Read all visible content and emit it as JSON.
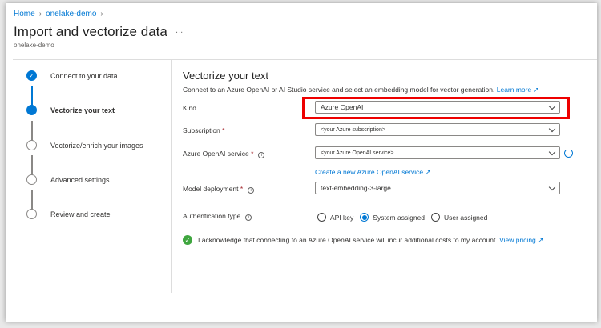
{
  "breadcrumb": [
    "Home",
    "onelake-demo"
  ],
  "header": {
    "title": "Import and vectorize data",
    "more": "...",
    "subtitle": "onelake-demo"
  },
  "steps": [
    {
      "label": "Connect to your data",
      "state": "done"
    },
    {
      "label": "Vectorize your text",
      "state": "current"
    },
    {
      "label": "Vectorize/enrich your images",
      "state": "pending"
    },
    {
      "label": "Advanced settings",
      "state": "pending"
    },
    {
      "label": "Review and create",
      "state": "pending"
    }
  ],
  "main": {
    "title": "Vectorize your text",
    "description": "Connect to an Azure OpenAI or AI Studio service and select an embedding model for vector generation.",
    "learn_more": "Learn more",
    "kind": {
      "label": "Kind",
      "value": "Azure OpenAI"
    },
    "subscription": {
      "label": "Subscription",
      "required": "*",
      "value": "<your Azure subscription>"
    },
    "service": {
      "label": "Azure OpenAI service",
      "required": "*",
      "value": "<your Azure OpenAI service>",
      "create_link": "Create a new Azure OpenAI service"
    },
    "model": {
      "label": "Model deployment",
      "required": "*",
      "value": "text-embedding-3-large"
    },
    "auth": {
      "label": "Authentication type",
      "options": [
        "API key",
        "System assigned",
        "User assigned"
      ],
      "selected": "System assigned"
    },
    "ack": {
      "text": "I acknowledge that connecting to an Azure OpenAI service will incur additional costs to my account.",
      "link": "View pricing",
      "checked": true
    }
  },
  "colors": {
    "accent": "#0078d4",
    "highlight": "#e00000",
    "success": "#3fa63f"
  }
}
